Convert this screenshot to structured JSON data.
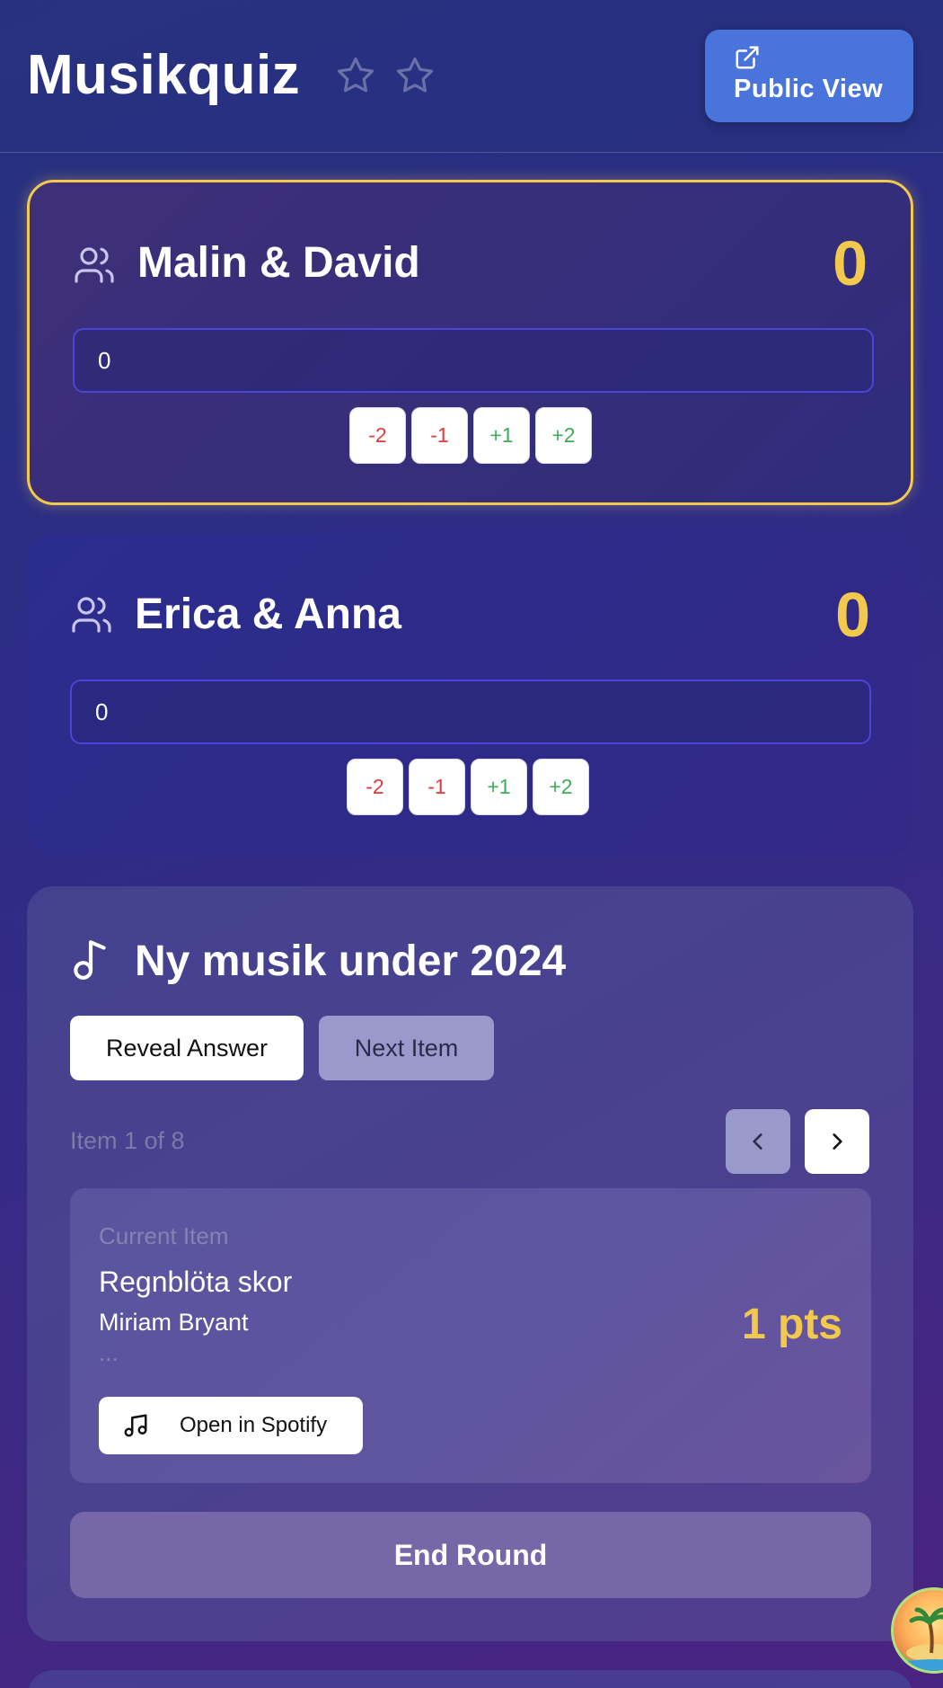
{
  "header": {
    "title": "Musikquiz",
    "stars": [
      "star-icon",
      "star-icon"
    ],
    "public_view_label": "Public View",
    "public_view_icon": "external-link-icon"
  },
  "teams": [
    {
      "name": "Malin & David",
      "score": "0",
      "input_value": "0",
      "active": true,
      "adjust": [
        "-2",
        "-1",
        "+1",
        "+2"
      ]
    },
    {
      "name": "Erica & Anna",
      "score": "0",
      "input_value": "0",
      "active": false,
      "adjust": [
        "-2",
        "-1",
        "+1",
        "+2"
      ]
    }
  ],
  "round": {
    "title": "Ny musik under 2024",
    "reveal_label": "Reveal Answer",
    "next_label": "Next Item",
    "counter": "Item 1 of 8",
    "current_caption": "Current Item",
    "song_title": "Regnblöta skor",
    "song_artist": "Miriam Bryant",
    "ellipsis": "...",
    "points": "1 pts",
    "spotify_label": "Open in Spotify",
    "end_label": "End Round"
  },
  "colors": {
    "accent_gold": "#f2c94c",
    "primary_button": "#4874dc",
    "negative": "#e0393e",
    "positive": "#3dad5a"
  }
}
